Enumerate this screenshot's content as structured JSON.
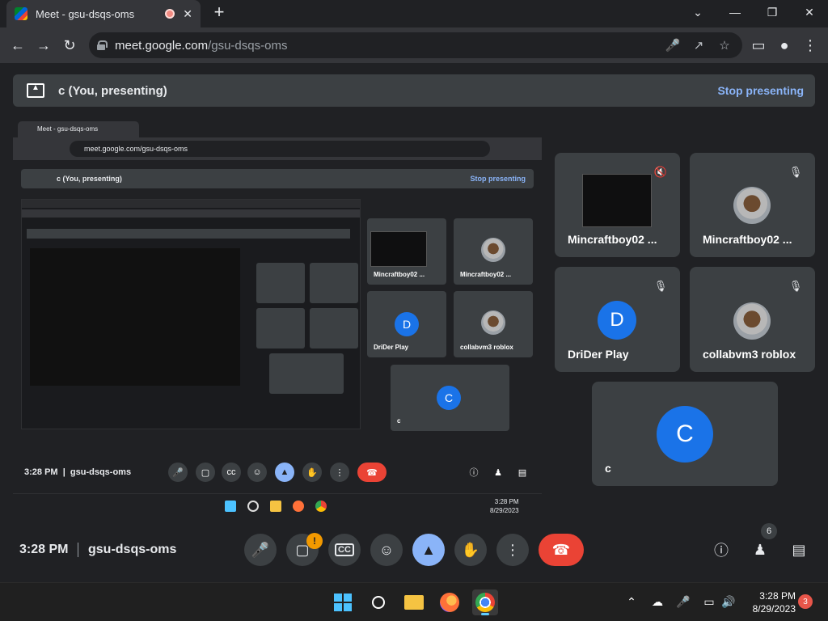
{
  "browser": {
    "tab_title": "Meet - gsu-dsqs-oms",
    "tab_close": "✕",
    "new_tab": "+",
    "url_host": "meet.google.com",
    "url_path": "/gsu-dsqs-oms"
  },
  "banner": {
    "presenter": "c (You, presenting)",
    "stop_label": "Stop presenting"
  },
  "participants": [
    {
      "name": "Mincraftboy02 ...",
      "kind": "screen",
      "muted_icon": "speaker-off-icon"
    },
    {
      "name": "Mincraftboy02 ...",
      "kind": "roblox-avatar",
      "muted_icon": "mic-off-icon"
    },
    {
      "name": "DriDer Play",
      "initial": "D",
      "muted_icon": "mic-off-icon"
    },
    {
      "name": "collabvm3 roblox",
      "kind": "roblox-avatar",
      "muted_icon": "mic-off-icon"
    },
    {
      "name": "c",
      "initial": "C"
    }
  ],
  "meeting": {
    "time": "3:28 PM",
    "code": "gsu-dsqs-oms",
    "camera_badge": "!",
    "people_count": "6"
  },
  "presented": {
    "tab_title": "Meet - gsu-dsqs-oms",
    "url": "meet.google.com/gsu-dsqs-oms",
    "presenter": "c (You, presenting)",
    "stop_label": "Stop presenting",
    "time": "3:28 PM",
    "code": "gsu-dsqs-oms",
    "tiles": [
      {
        "name": "Mincraftboy02 ..."
      },
      {
        "name": "Mincraftboy02 ..."
      },
      {
        "name": "DriDer Play",
        "initial": "D"
      },
      {
        "name": "collabvm3 roblox"
      },
      {
        "name": "c",
        "initial": "C"
      }
    ],
    "clock_time": "3:28 PM",
    "clock_date": "8/29/2023",
    "notif": "3",
    "people_count": "6"
  },
  "taskbar": {
    "clock_time": "3:28 PM",
    "clock_date": "8/29/2023",
    "notification_count": "3"
  },
  "colors": {
    "accent": "#8ab4f8",
    "hangup": "#ea4335",
    "avatar": "#1a73e8",
    "tile": "#3c4043"
  }
}
